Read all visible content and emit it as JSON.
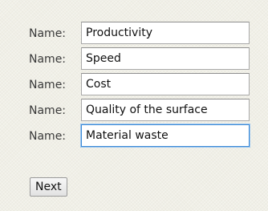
{
  "form": {
    "rows": [
      {
        "label": "Name:",
        "value": "Productivity"
      },
      {
        "label": "Name:",
        "value": "Speed"
      },
      {
        "label": "Name:",
        "value": "Cost"
      },
      {
        "label": "Name:",
        "value": "Quality of the surface"
      },
      {
        "label": "Name:",
        "value": "Material waste"
      }
    ],
    "focused_row": 4,
    "next_label": "Next"
  },
  "colors": {
    "background": "#f0efe6",
    "focus_border": "#3d8ad6"
  }
}
